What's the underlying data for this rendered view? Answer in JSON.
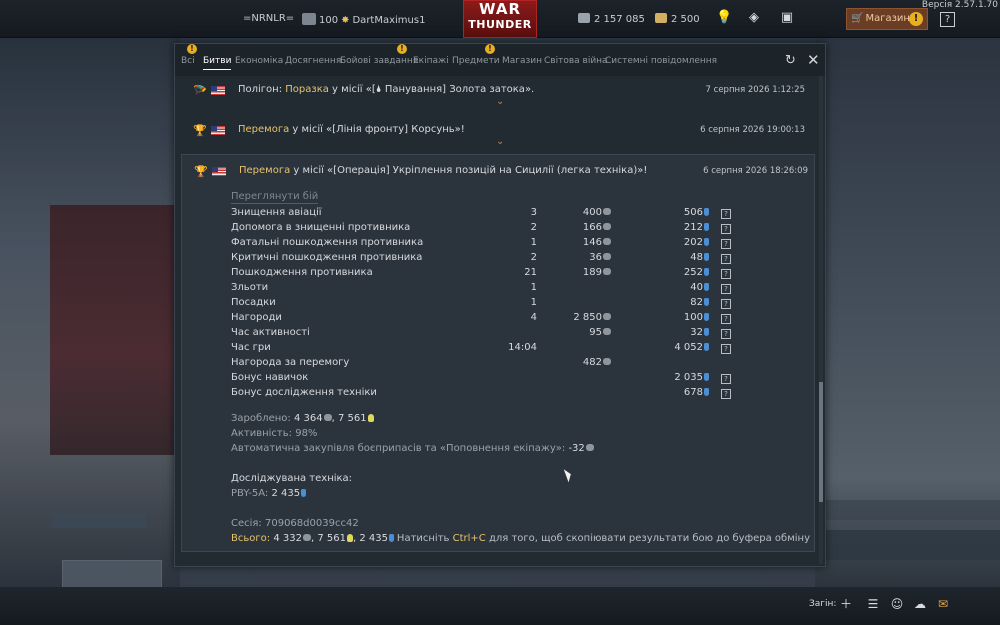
{
  "version": "Версія 2.57.1.70",
  "topbar": {
    "squadron": "=NRNLR=",
    "rank": "100",
    "nickname": "DartMaximus1",
    "logo_line1": "WAR",
    "logo_line2": "THUNDER",
    "silver_lions": "2 157 085",
    "golden_eagles": "2 500",
    "shop_label": "Магазин",
    "help_label": "?",
    "icons": [
      "rank-icon",
      "star-icon",
      "silver-lions-icon",
      "golden-eagles-icon",
      "bulb-icon",
      "dice-icon",
      "ticket-icon",
      "cart-icon",
      "warning-icon",
      "help-icon"
    ]
  },
  "dialog": {
    "tabs": [
      {
        "label": "Всі",
        "warn": true
      },
      {
        "label": "Битви",
        "active": true
      },
      {
        "label": "Економіка"
      },
      {
        "label": "Досягнення"
      },
      {
        "label": "Бойові завдання",
        "warn": true
      },
      {
        "label": "Екіпажі"
      },
      {
        "label": "Предмети",
        "warn": true
      },
      {
        "label": "Магазин"
      },
      {
        "label": "Світова війна"
      },
      {
        "label": "Системні повідомлення"
      }
    ],
    "entries": [
      {
        "prefix": "Полігон: ",
        "result": "Поразка",
        "text": " у місії «[",
        "icon": "🌢",
        "text2": " Панування] Золота затока».",
        "date": "7 серпня 2026 1:12:25"
      },
      {
        "result": "Перемога",
        "text": " у місії «[Лінія фронту] Корсунь»!",
        "date": "6 серпня 2026 19:00:13"
      },
      {
        "result": "Перемога",
        "text": " у місії «[Операція] Укріплення позицій на Сицилії (легка техніка)»!",
        "date": "6 серпня 2026 18:26:09",
        "review_link": "Переглянути бій",
        "stats": [
          {
            "label": "Знищення авіації",
            "count": "3",
            "lions": "400",
            "rp": "506"
          },
          {
            "label": "Допомога в знищенні противника",
            "count": "2",
            "lions": "166",
            "rp": "212"
          },
          {
            "label": "Фатальні пошкодження противника",
            "count": "1",
            "lions": "146",
            "rp": "202"
          },
          {
            "label": "Критичні пошкодження противника",
            "count": "2",
            "lions": "36",
            "rp": "48"
          },
          {
            "label": "Пошкодження противника",
            "count": "21",
            "lions": "189",
            "rp": "252"
          },
          {
            "label": "Зльоти",
            "count": "1",
            "lions": "",
            "rp": "40"
          },
          {
            "label": "Посадки",
            "count": "1",
            "lions": "",
            "rp": "82"
          },
          {
            "label": "Нагороди",
            "count": "4",
            "lions": "2 850",
            "rp": "100"
          },
          {
            "label": "Час активності",
            "count": "",
            "lions": "95",
            "rp": "32"
          },
          {
            "label": "Час гри",
            "count": "14:04",
            "lions": "",
            "rp": "4 052"
          },
          {
            "label": "Нагорода за перемогу",
            "count": "",
            "lions": "482",
            "rp": ""
          },
          {
            "label": "Бонус навичок",
            "count": "",
            "lions": "",
            "rp": "2 035"
          },
          {
            "label": "Бонус дослідження техніки",
            "count": "",
            "lions": "",
            "rp": "678"
          }
        ],
        "earned_label": "Зароблено:",
        "earned_lions": "4 364",
        "earned_rp": "7 561",
        "activity_label": "Активність:",
        "activity_value": "98%",
        "autobuy_label": "Автоматична закупівля боєприпасів та «Поповнення екіпажу»:",
        "autobuy_value": "-32",
        "research_label": "Досліджувана техніка:",
        "research_vehicle": "PBY-5A:",
        "research_rp": "2 435",
        "session_label": "Сесія:",
        "session_id": "709068d0039cc42",
        "total_label": "Всього:",
        "total_lions": "4 332",
        "total_rp": "7 561",
        "total_research": "2 435",
        "copy_hint_pre": "Натисніть ",
        "copy_hint_key": "Ctrl+C",
        "copy_hint_post": " для того, щоб скопіювати результати бою до буфера обміну"
      }
    ]
  },
  "bottombar": {
    "squad_label": "Загін:",
    "icons": [
      "plus-icon",
      "list-icon",
      "friends-icon",
      "chat-icon",
      "mail-icon"
    ]
  },
  "colors": {
    "accent_gold": "#e6c36e",
    "rp_blue": "#4a8ed4",
    "shop_bg": "#6a3d24",
    "logo_red": "#8e1a1a"
  }
}
